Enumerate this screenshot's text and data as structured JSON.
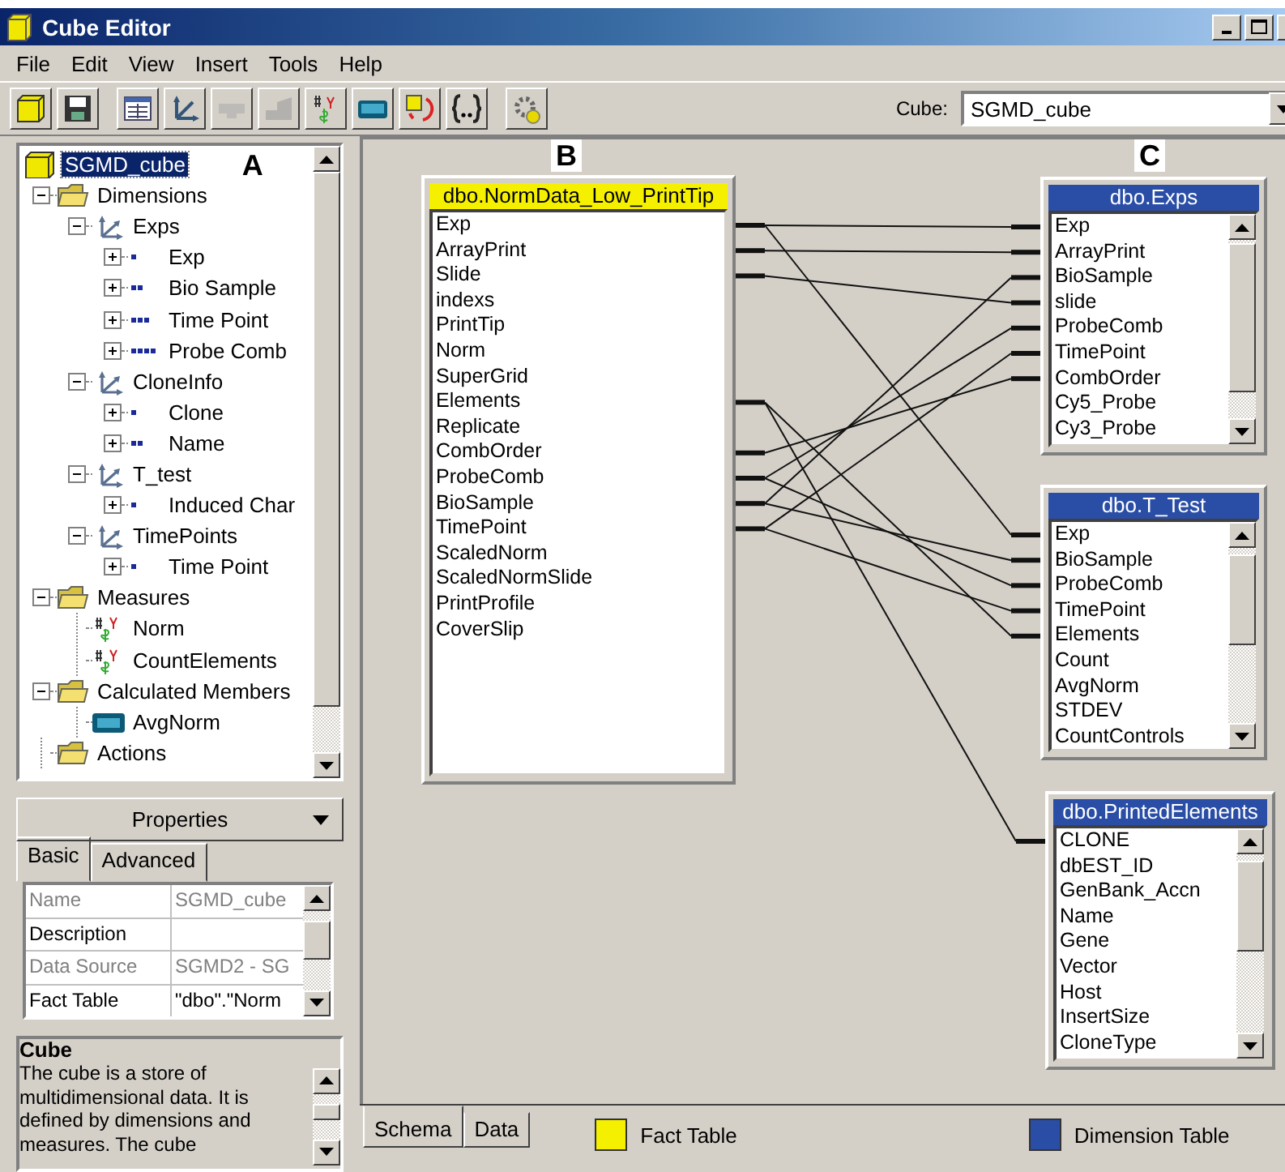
{
  "window": {
    "title": "Cube Editor"
  },
  "menu": [
    "File",
    "Edit",
    "View",
    "Insert",
    "Tools",
    "Help"
  ],
  "toolbar": [
    {
      "disabled": false
    },
    {
      "disabled": false
    },
    {
      "disabled": false
    },
    {
      "disabled": false
    },
    {
      "disabled": true
    },
    {
      "disabled": true
    },
    {
      "disabled": false
    },
    {
      "disabled": false
    },
    {
      "disabled": false
    },
    {
      "disabled": false
    },
    {
      "disabled": false
    }
  ],
  "cube_selector": {
    "label": "Cube:",
    "value": "SGMD_cube"
  },
  "tree": {
    "label": "A",
    "items": [
      {
        "label": "SGMD_cube",
        "kind": "cube",
        "selected": true,
        "children": [
          {
            "label": "Dimensions",
            "kind": "folder",
            "selected": false,
            "expanded": true,
            "children": [
              {
                "label": "Exps",
                "kind": "dimension",
                "selected": false,
                "expanded": true,
                "children": [
                  {
                    "label": "Exp",
                    "kind": "level",
                    "selected": false,
                    "expanded": false
                  },
                  {
                    "label": "Bio Sample",
                    "kind": "level",
                    "selected": false,
                    "expanded": false
                  },
                  {
                    "label": "Time Point",
                    "kind": "level",
                    "selected": false,
                    "expanded": false
                  },
                  {
                    "label": "Probe Comb",
                    "kind": "level",
                    "selected": false,
                    "expanded": false
                  }
                ]
              },
              {
                "label": "CloneInfo",
                "kind": "dimension",
                "selected": false,
                "expanded": true,
                "children": [
                  {
                    "label": "Clone",
                    "kind": "level",
                    "selected": false,
                    "expanded": false
                  },
                  {
                    "label": "Name",
                    "kind": "level",
                    "selected": false,
                    "expanded": false
                  }
                ]
              },
              {
                "label": "T_test",
                "kind": "dimension",
                "selected": false,
                "expanded": true,
                "children": [
                  {
                    "label": "Induced Char",
                    "kind": "level",
                    "selected": false,
                    "expanded": false
                  }
                ]
              },
              {
                "label": "TimePoints",
                "kind": "dimension",
                "selected": false,
                "expanded": true,
                "children": [
                  {
                    "label": "Time Point",
                    "kind": "level",
                    "selected": false,
                    "expanded": false
                  }
                ]
              }
            ]
          },
          {
            "label": "Measures",
            "kind": "folder",
            "selected": false,
            "expanded": true,
            "children": [
              {
                "label": "Norm",
                "kind": "measure",
                "selected": false
              },
              {
                "label": "CountElements",
                "kind": "measure",
                "selected": false
              }
            ]
          },
          {
            "label": "Calculated Members",
            "kind": "folder",
            "selected": false,
            "expanded": true,
            "children": [
              {
                "label": "AvgNorm",
                "kind": "calc",
                "selected": false
              }
            ]
          },
          {
            "label": "Actions",
            "kind": "folder",
            "selected": false
          }
        ]
      }
    ]
  },
  "properties": {
    "title": "Properties",
    "tabs": [
      {
        "label": "Basic",
        "selected": true
      },
      {
        "label": "Advanced",
        "selected": false
      }
    ],
    "rows": [
      {
        "name": "Name",
        "value": "SGMD_cube",
        "disabled": true
      },
      {
        "name": "Description",
        "disabled": false
      },
      {
        "name": "Data Source",
        "value": "SGMD2 - SG",
        "disabled": true
      },
      {
        "name": "Fact Table",
        "value": "\"dbo\".\"Norm",
        "disabled": false
      }
    ]
  },
  "description": {
    "title": "Cube",
    "text": "The cube is a store of multidimensional data. It is defined by dimensions and measures. The cube"
  },
  "tables": [
    {
      "kind": "fact",
      "label": "B",
      "name": "dbo.NormData_Low_PrintTip",
      "fields": [
        {
          "name": "Exp",
          "linked": true
        },
        {
          "name": "ArrayPrint",
          "linked": true
        },
        {
          "name": "Slide",
          "linked": true
        },
        {
          "name": "indexs",
          "linked": false
        },
        {
          "name": "PrintTip",
          "linked": false
        },
        {
          "name": "Norm",
          "linked": false
        },
        {
          "name": "SuperGrid",
          "linked": false
        },
        {
          "name": "Elements",
          "linked": true
        },
        {
          "name": "Replicate",
          "linked": false
        },
        {
          "name": "CombOrder",
          "linked": true
        },
        {
          "name": "ProbeComb",
          "linked": true
        },
        {
          "name": "BioSample",
          "linked": true
        },
        {
          "name": "TimePoint",
          "linked": true
        },
        {
          "name": "ScaledNorm",
          "linked": false
        },
        {
          "name": "ScaledNormSlide",
          "linked": false
        },
        {
          "name": "PrintProfile",
          "linked": false
        },
        {
          "name": "CoverSlip",
          "linked": false
        }
      ]
    },
    {
      "kind": "dimension",
      "label": "C",
      "name": "dbo.Exps",
      "fields": [
        {
          "name": "Exp",
          "linked": true
        },
        {
          "name": "ArrayPrint",
          "linked": true
        },
        {
          "name": "BioSample",
          "linked": true
        },
        {
          "name": "slide",
          "linked": true
        },
        {
          "name": "ProbeComb",
          "linked": true
        },
        {
          "name": "TimePoint",
          "linked": true
        },
        {
          "name": "CombOrder",
          "linked": true
        },
        {
          "name": "Cy5_Probe",
          "linked": false
        },
        {
          "name": "Cy3_Probe",
          "linked": false
        }
      ]
    },
    {
      "kind": "dimension",
      "name": "dbo.T_Test",
      "fields": [
        {
          "name": "Exp",
          "linked": true
        },
        {
          "name": "BioSample",
          "linked": true
        },
        {
          "name": "ProbeComb",
          "linked": true
        },
        {
          "name": "TimePoint",
          "linked": true
        },
        {
          "name": "Elements",
          "linked": true
        },
        {
          "name": "Count",
          "linked": false
        },
        {
          "name": "AvgNorm",
          "linked": false
        },
        {
          "name": "STDEV",
          "linked": false
        },
        {
          "name": "CountControls",
          "linked": false
        }
      ]
    },
    {
      "kind": "dimension",
      "name": "dbo.PrintedElements",
      "fields": [
        {
          "name": "CLONE",
          "linked": true
        },
        {
          "name": "dbEST_ID",
          "linked": false
        },
        {
          "name": "GenBank_Accn",
          "linked": false
        },
        {
          "name": "Name",
          "linked": false
        },
        {
          "name": "Gene",
          "linked": false
        },
        {
          "name": "Vector",
          "linked": false
        },
        {
          "name": "Host",
          "linked": false
        },
        {
          "name": "InsertSize",
          "linked": false
        },
        {
          "name": "CloneType",
          "linked": false
        }
      ]
    }
  ],
  "view_tabs": [
    {
      "label": "Schema",
      "selected": true
    },
    {
      "label": "Data",
      "selected": false
    }
  ],
  "legend": [
    {
      "label": "Fact Table",
      "color": "#f5f000"
    },
    {
      "label": "Dimension Table",
      "color": "#2a4ea6"
    }
  ]
}
